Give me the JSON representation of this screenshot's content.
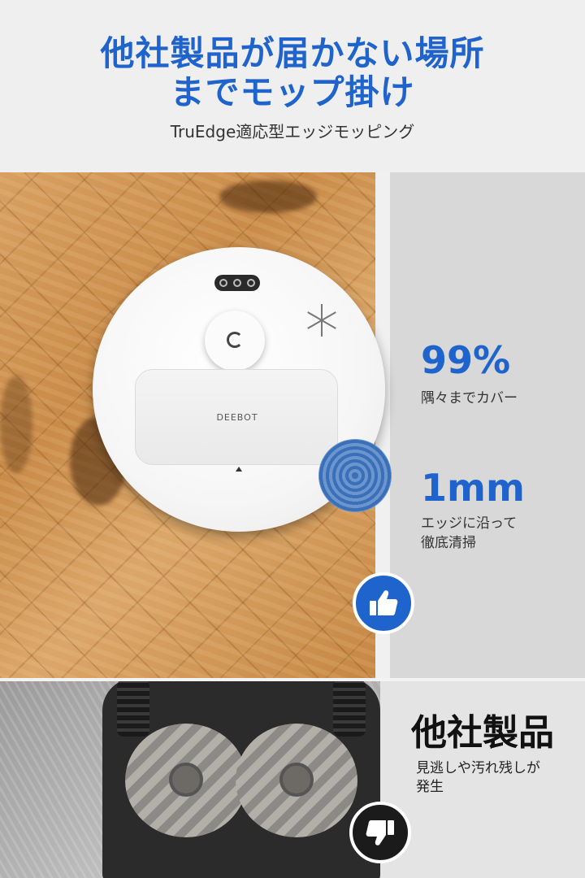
{
  "header": {
    "title_line1": "他社製品が届かない場所",
    "title_line2": "までモップ掛け",
    "subtitle": "TruEdge適応型エッジモッピング"
  },
  "product": {
    "brand_label": "DEEBOT"
  },
  "stats": [
    {
      "value": "99%",
      "label_line1": "隅々までカバー",
      "label_line2": ""
    },
    {
      "value": "1mm",
      "label_line1": "エッジに沿って",
      "label_line2": "徹底清掃"
    }
  ],
  "competitor": {
    "title": "他社製品",
    "desc_line1": "見逃しや汚れ残しが",
    "desc_line2": "発生"
  },
  "icons": {
    "good": "thumbs-up-icon",
    "bad": "thumbs-down-icon"
  },
  "colors": {
    "accent": "#1f63cc",
    "dark": "#1b1b1b"
  }
}
